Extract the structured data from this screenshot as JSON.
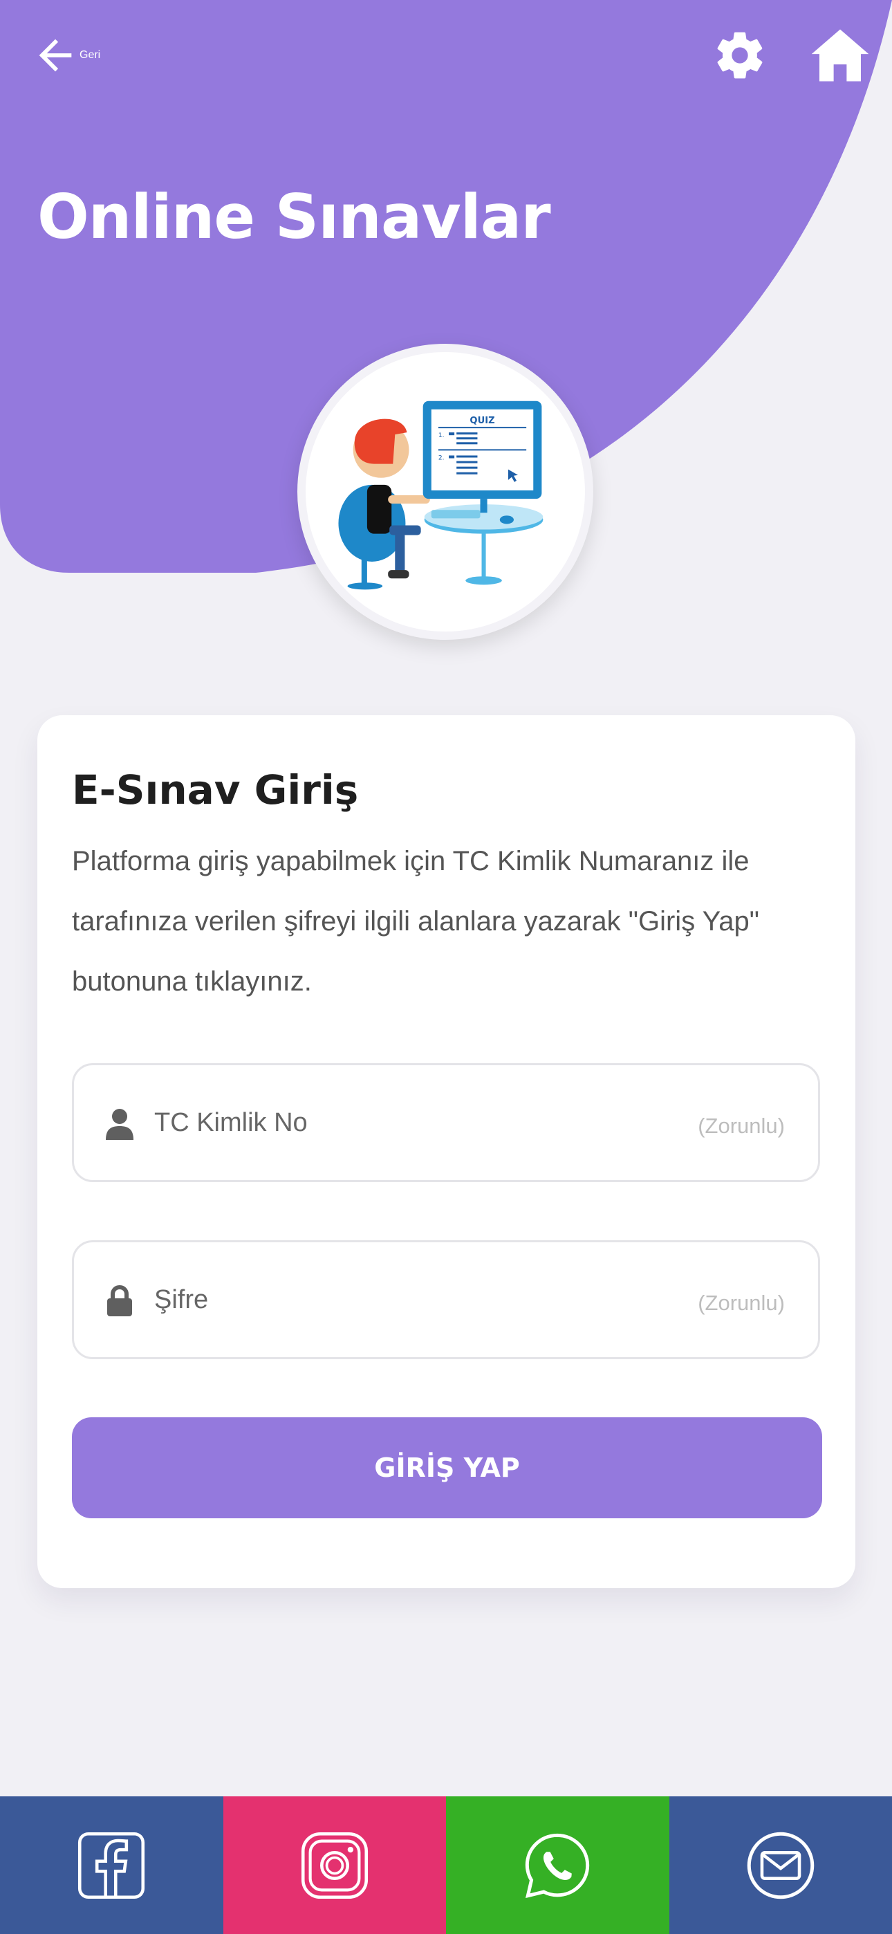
{
  "header": {
    "back_label": "Geri",
    "page_title": "Online Sınavlar",
    "illustration_text": "QUIZ"
  },
  "login_card": {
    "title": "E-Sınav Giriş",
    "description": "Platforma giriş yapabilmek için TC Kimlik Numaranız ile tarafınıza verilen şifreyi ilgili alanlara yazarak \"Giriş Yap\" butonuna tıklayınız.",
    "tc_field": {
      "placeholder": "TC Kimlik No",
      "required_label": "(Zorunlu)"
    },
    "password_field": {
      "placeholder": "Şifre",
      "required_label": "(Zorunlu)"
    },
    "submit_label": "GİRİŞ YAP"
  },
  "footer": {
    "items": [
      {
        "icon": "facebook-icon",
        "color": "#3b5998"
      },
      {
        "icon": "instagram-icon",
        "color": "#e4316f"
      },
      {
        "icon": "whatsapp-icon",
        "color": "#35b025"
      },
      {
        "icon": "mail-icon",
        "color": "#3b5998"
      }
    ]
  },
  "colors": {
    "accent": "#9479dd",
    "background": "#f1f0f5"
  }
}
